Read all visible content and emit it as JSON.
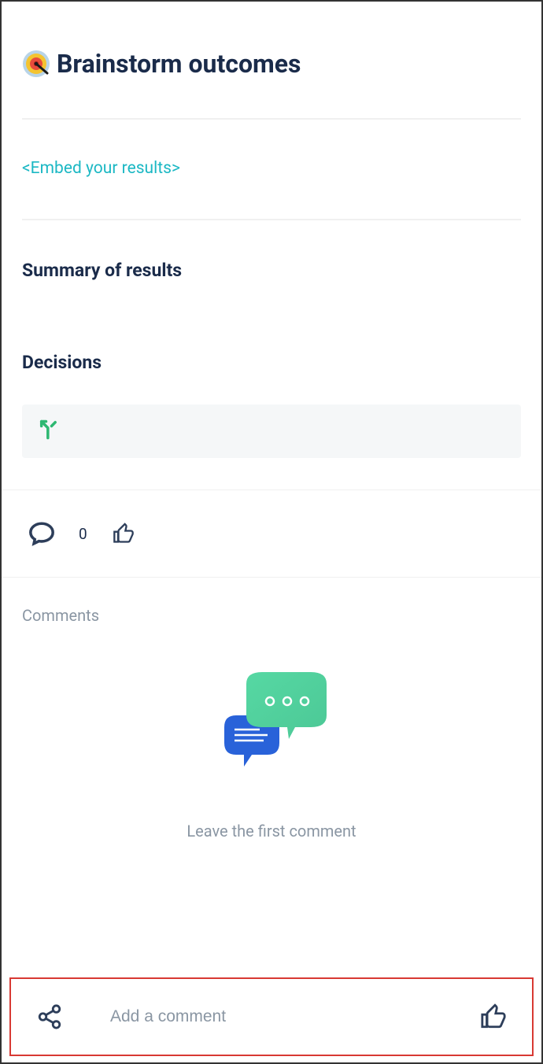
{
  "page": {
    "title": "Brainstorm outcomes",
    "embed_link": "<Embed your results>",
    "summary_heading": "Summary of results",
    "decisions_heading": "Decisions"
  },
  "reactions": {
    "comment_count": "0"
  },
  "comments": {
    "label": "Comments",
    "empty_text": "Leave the first comment",
    "input_placeholder": "Add a comment"
  }
}
